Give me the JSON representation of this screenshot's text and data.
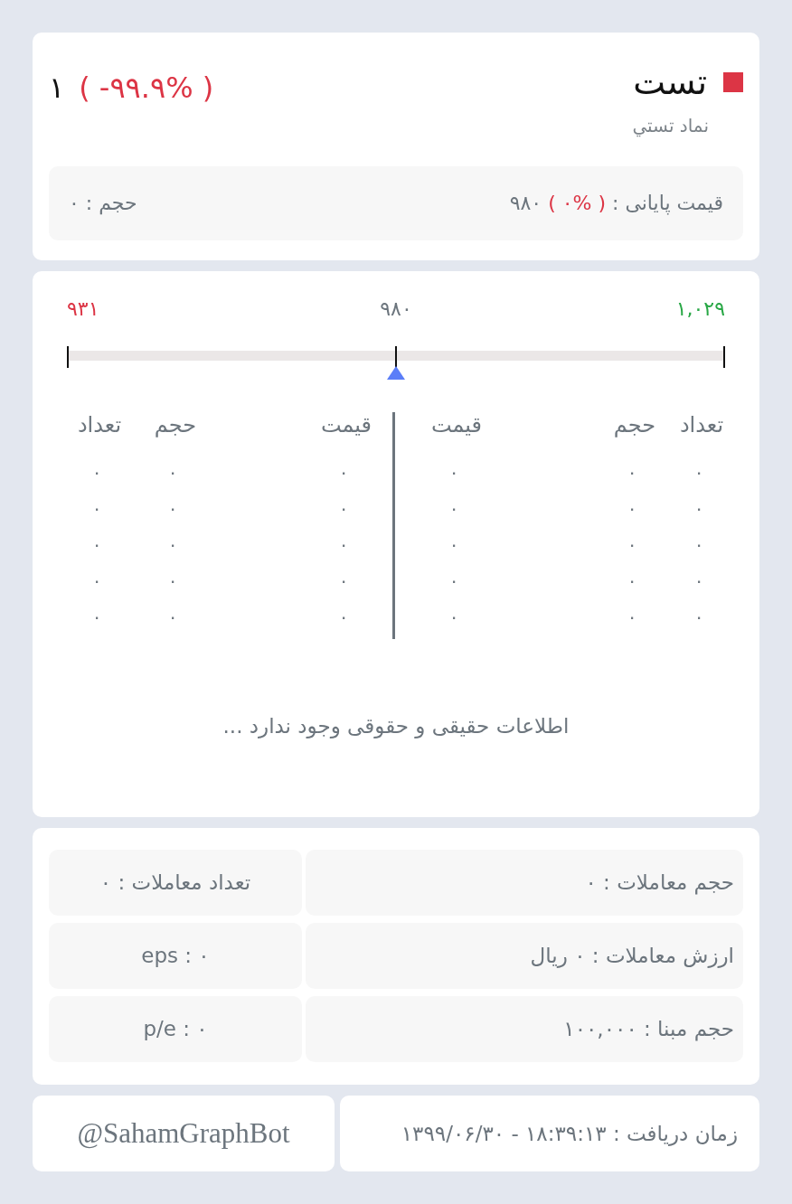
{
  "symbol": {
    "name": "تست",
    "description": "نماد تستي",
    "last_price": "۱",
    "change": "( -۹۹.۹% )"
  },
  "summary": {
    "close_label": "قیمت پایانی :",
    "close_change": "( ۰% )",
    "close_price": "۹۸۰",
    "volume": "حجم : ۰"
  },
  "price_range": {
    "high": "۱,۰۲۹",
    "mid": "۹۸۰",
    "low": "۹۳۱",
    "level": 0.5
  },
  "order_book": [
    {
      "columns": [
        "تعداد",
        "حجم",
        "قیمت"
      ],
      "rows": [
        [
          "۰",
          "۰",
          "۰"
        ],
        [
          "۰",
          "۰",
          "۰"
        ],
        [
          "۰",
          "۰",
          "۰"
        ],
        [
          "۰",
          "۰",
          "۰"
        ],
        [
          "۰",
          "۰",
          "۰"
        ]
      ]
    },
    {
      "columns": [
        "قیمت",
        "حجم",
        "تعداد"
      ],
      "rows": [
        [
          "۰",
          "۰",
          "۰"
        ],
        [
          "۰",
          "۰",
          "۰"
        ],
        [
          "۰",
          "۰",
          "۰"
        ],
        [
          "۰",
          "۰",
          "۰"
        ],
        [
          "۰",
          "۰",
          "۰"
        ]
      ]
    }
  ],
  "notice": "اطلاعات حقیقی و حقوقی وجود ندارد ...",
  "stats": [
    "حجم معاملات : ۰",
    "تعداد معاملات : ۰",
    "ارزش معاملات : ۰ ریال",
    "eps : ۰",
    "حجم مبنا : ۱۰۰,۰۰۰",
    "p/e : ۰"
  ],
  "footer": {
    "received_time": "زمان دریافت : ۱۸:۳۹:۱۳ - ۱۳۹۹/۰۶/۳۰",
    "bot_handle": "@SahamGraphBot"
  }
}
